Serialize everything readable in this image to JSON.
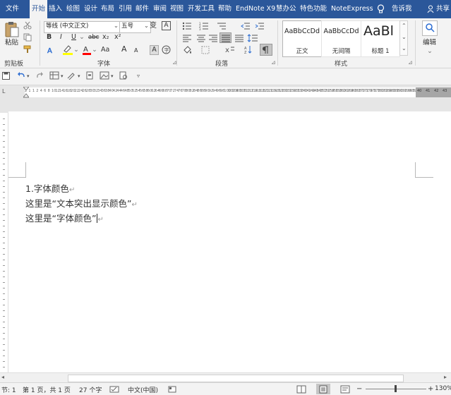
{
  "menu": {
    "tabs": [
      {
        "label": "文件"
      },
      {
        "label": "开始"
      },
      {
        "label": "插入"
      },
      {
        "label": "绘图"
      },
      {
        "label": "设计"
      },
      {
        "label": "布局"
      },
      {
        "label": "引用"
      },
      {
        "label": "邮件"
      },
      {
        "label": "审阅"
      },
      {
        "label": "视图"
      },
      {
        "label": "开发工具"
      },
      {
        "label": "帮助"
      },
      {
        "label": "EndNote X9"
      },
      {
        "label": "慧办公"
      },
      {
        "label": "特色功能"
      },
      {
        "label": "NoteExpress"
      }
    ],
    "tell_me": "告诉我",
    "share": "共享"
  },
  "ribbon": {
    "clipboard": {
      "paste": "粘贴",
      "group": "剪贴板"
    },
    "font": {
      "family": "等线 (中文正文)",
      "size": "五号",
      "group": "字体",
      "bold": "B",
      "italic": "I",
      "underline": "U",
      "strike": "abc",
      "sub": "x₂",
      "sup": "x²",
      "case": "Aa",
      "grow": "A",
      "shrink": "A",
      "clear": "A",
      "pinyin": "变",
      "border_char": "A"
    },
    "paragraph": {
      "group": "段落"
    },
    "styles": {
      "group": "样式",
      "items": [
        {
          "sample": "AaBbCcDd",
          "name": "正文"
        },
        {
          "sample": "AaBbCcDd",
          "name": "无间隔"
        },
        {
          "sample": "AaBl",
          "name": "标题 1"
        }
      ]
    },
    "editing": {
      "label": "编辑"
    }
  },
  "ruler": {
    "left": "L",
    "numbers": [
      "2",
      "1",
      "1",
      "2",
      "4",
      "6",
      "8",
      "10",
      "12",
      "14",
      "16",
      "18",
      "20",
      "22",
      "24",
      "26",
      "28",
      "30",
      "32",
      "34",
      "36",
      "38",
      "40",
      "42",
      "44",
      "46",
      "48",
      "50",
      "52",
      "54",
      "56",
      "58",
      "60",
      "62",
      "64",
      "66",
      "68",
      "70",
      "72",
      "74",
      "76",
      "78",
      "80",
      "82",
      "84",
      "86",
      "88",
      "90",
      "92",
      "94",
      "96",
      "98",
      "100",
      "102",
      "104",
      "106",
      "108",
      "110",
      "112",
      "114",
      "116",
      "118",
      "120",
      "122",
      "124",
      "126",
      "128",
      "130",
      "132",
      "134",
      "136",
      "138",
      "140",
      "142",
      "144",
      "146",
      "148",
      "150",
      "152",
      "154",
      "156",
      "158",
      "160",
      "162",
      "164",
      "166",
      "168",
      "170",
      "172",
      "174",
      "176",
      "178",
      "180",
      "182",
      "184",
      "186",
      "188",
      "190",
      "192",
      "194",
      "196",
      "198"
    ],
    "right_numbers": [
      "40",
      "41",
      "42",
      "43"
    ]
  },
  "document": {
    "paragraphs": [
      {
        "text": "1.字体颜色",
        "mark": "↵"
      },
      {
        "text": "这里是“文本突出显示颜色”",
        "mark": "↵"
      },
      {
        "text": "这里是“字体颜色”",
        "mark": "↵"
      }
    ]
  },
  "status": {
    "section": "节: 1",
    "page": "第 1 页，共 1 页",
    "words": "27 个字",
    "language": "中文(中国)",
    "zoom": "130%"
  },
  "colors": {
    "accent": "#2b579a",
    "highlight": "#ffff00",
    "font_color": "#ff0000"
  }
}
